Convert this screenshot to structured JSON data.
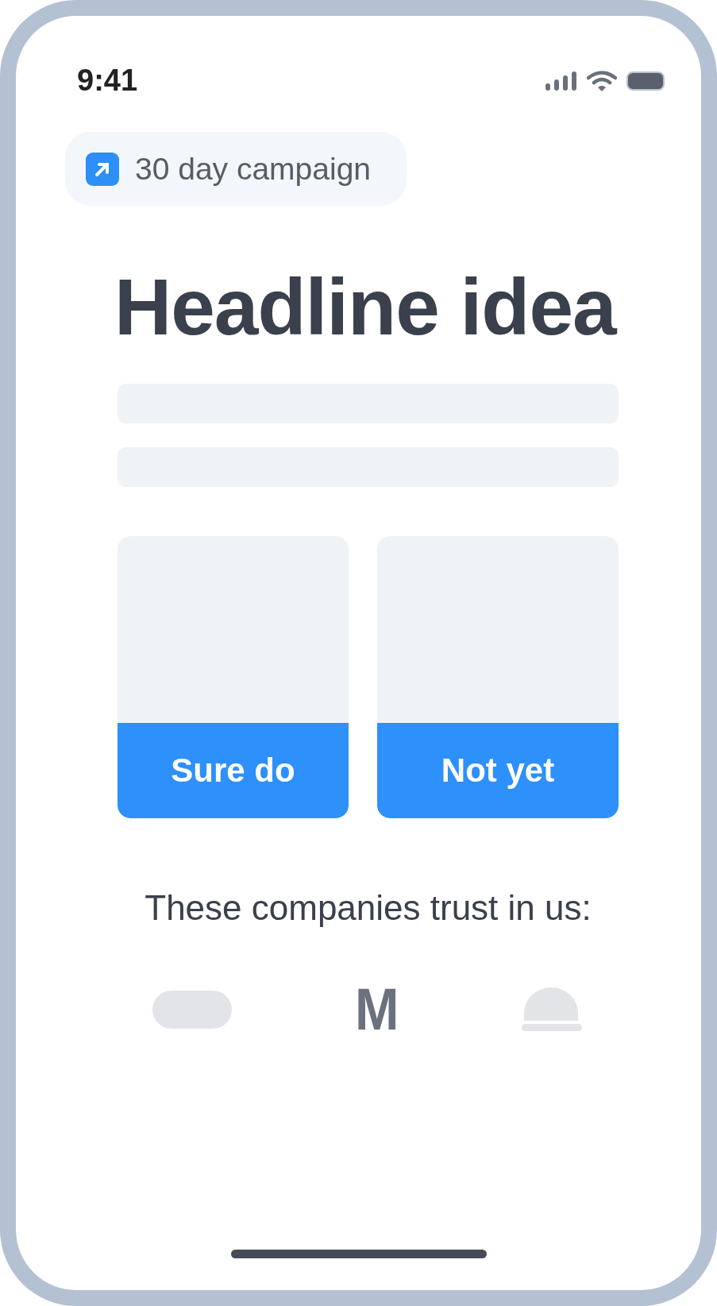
{
  "status_bar": {
    "time": "9:41"
  },
  "badge": {
    "label": "30 day campaign"
  },
  "headline": "Headline idea",
  "text_placeholders": [
    {
      "kind": "bar"
    },
    {
      "kind": "bar"
    }
  ],
  "choices": [
    {
      "label": "Sure do"
    },
    {
      "label": "Not yet"
    }
  ],
  "trust_text": "These companies trust in us:",
  "logos": [
    {
      "kind": "pill"
    },
    {
      "kind": "letter",
      "text": "M"
    },
    {
      "kind": "dome"
    }
  ]
}
